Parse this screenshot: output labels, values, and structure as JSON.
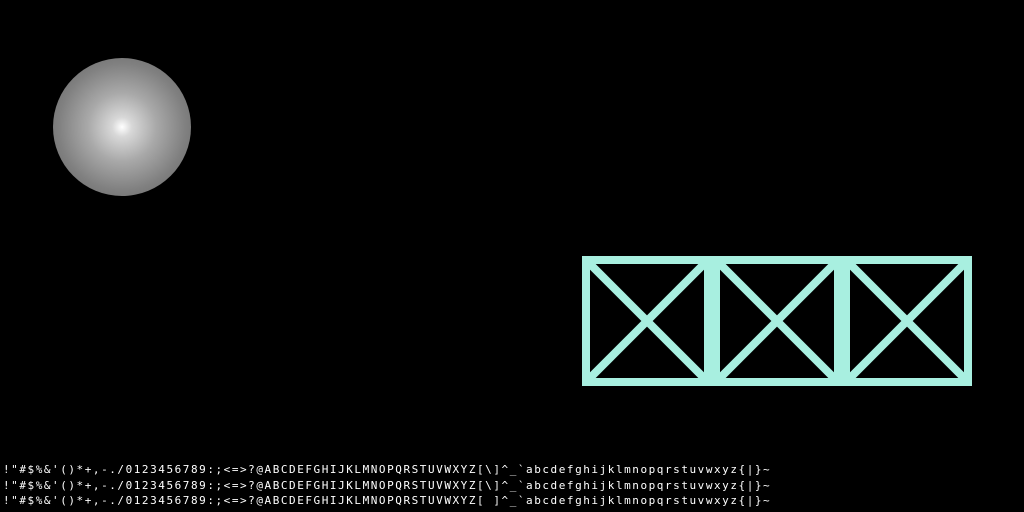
{
  "scene": {
    "background_color": "#000000",
    "sphere": {
      "highlight_color": "#ffffff",
      "shade_color": "#5f5f5f"
    },
    "truss": {
      "color": "#a8efe0",
      "panel_count": 3
    }
  },
  "font_test": {
    "lines": [
      "!\"#$%&'()*+,-./0123456789:;<=>?@ABCDEFGHIJKLMNOPQRSTUVWXYZ[\\]^_`abcdefghijklmnopqrstuvwxyz{|}~",
      "!\"#$%&'()*+,-./0123456789:;<=>?@ABCDEFGHIJKLMNOPQRSTUVWXYZ[\\]^_`abcdefghijklmnopqrstuvwxyz{|}~",
      "!\"#$%&'()*+,-./0123456789:;<=>?@ABCDEFGHIJKLMNOPQRSTUVWXYZ[ ]^_`abcdefghijklmnopqrstuvwxyz{|}~"
    ]
  }
}
